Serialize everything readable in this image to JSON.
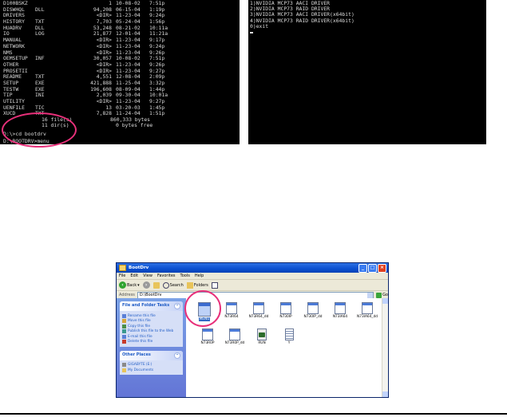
{
  "dos1": {
    "files": [
      {
        "name": "D100BSKZ",
        "ext": "",
        "size": "1",
        "date": "10-08-02",
        "time": "7:51p"
      },
      {
        "name": "DISWHQL",
        "ext": "DLL",
        "size": "94,208",
        "date": "06-15-04",
        "time": "1:19p"
      },
      {
        "name": "DRIVERS",
        "ext": "",
        "size": "<DIR>",
        "date": "11-23-04",
        "time": "9:24p"
      },
      {
        "name": "HISTORY",
        "ext": "TXT",
        "size": "7,703",
        "date": "05-24-04",
        "time": "1:56p"
      },
      {
        "name": "HUADRV",
        "ext": "DLL",
        "size": "53,248",
        "date": "08-21-02",
        "time": "10:11a"
      },
      {
        "name": "IO",
        "ext": "LOG",
        "size": "21,877",
        "date": "12-01-04",
        "time": "11:21a"
      },
      {
        "name": "MANUAL",
        "ext": "",
        "size": "<DIR>",
        "date": "11-23-04",
        "time": "9:17p"
      },
      {
        "name": "NETWORK",
        "ext": "",
        "size": "<DIR>",
        "date": "11-23-04",
        "time": "9:24p"
      },
      {
        "name": "NMS",
        "ext": "",
        "size": "<DIR>",
        "date": "11-23-04",
        "time": "9:26p"
      },
      {
        "name": "OEMSETUP",
        "ext": "INF",
        "size": "30,057",
        "date": "10-08-02",
        "time": "7:51p"
      },
      {
        "name": "OTHER",
        "ext": "",
        "size": "<DIR>",
        "date": "11-23-04",
        "time": "9:26p"
      },
      {
        "name": "PROSETII",
        "ext": "",
        "size": "<DIR>",
        "date": "11-23-04",
        "time": "9:27p"
      },
      {
        "name": "README",
        "ext": "TXT",
        "size": "4,551",
        "date": "12-08-04",
        "time": "2:09p"
      },
      {
        "name": "SETUP",
        "ext": "EXE",
        "size": "421,888",
        "date": "11-25-04",
        "time": "3:32p"
      },
      {
        "name": "TESTW",
        "ext": "EXE",
        "size": "196,608",
        "date": "08-09-04",
        "time": "1:44p"
      },
      {
        "name": "TIP",
        "ext": "INI",
        "size": "2,039",
        "date": "09-30-04",
        "time": "10:01a"
      },
      {
        "name": "UTILITY",
        "ext": "",
        "size": "<DIR>",
        "date": "11-23-04",
        "time": "9:27p"
      },
      {
        "name": "UENFILE",
        "ext": "TIC",
        "size": "13",
        "date": "03-20-03",
        "time": "1:45p"
      },
      {
        "name": "XUCD",
        "ext": "TXT",
        "size": "7,828",
        "date": "11-24-04",
        "time": "1:51p"
      }
    ],
    "summary_files": "16 file(s)",
    "summary_bytes": "860,333 bytes",
    "summary_dirs": "11 dir(s)",
    "summary_free": "0 bytes free",
    "prompt1": "D:\\>cd bootdrv",
    "prompt2": "D:\\BOOTDRV>menu"
  },
  "dos2": {
    "menu": [
      "1)NVIDIA MCP73 AACI DRIVER",
      "2)NVIDIA MCP73 RAID DRIVER",
      "3)NVIDIA MCP73 AACI DRIVER(x64bit)",
      "4)NVIDIA MCP73 RAID DRIVER(x64bit)",
      "0)exit"
    ]
  },
  "explorer": {
    "title": "BootDrv",
    "menu": [
      "File",
      "Edit",
      "View",
      "Favorites",
      "Tools",
      "Help"
    ],
    "toolbar": {
      "back": "Back",
      "search": "Search",
      "folders": "Folders"
    },
    "address_label": "Address",
    "address_value": "D:\\BootDrv",
    "go_label": "Go",
    "task_title": "File and Folder Tasks",
    "tasks": [
      "Rename this file",
      "Move this file",
      "Copy this file",
      "Publish this file to the Web",
      "E-mail this file",
      "Delete this file"
    ],
    "other_title": "Other Places",
    "other_places": [
      "GIGABYTE (E:)",
      "My Documents"
    ],
    "files_row1": [
      "MENU",
      "N73R64",
      "N73R64_dd",
      "N730IP",
      "N730IP_dd",
      "N73IA64",
      "N73IA64_dd"
    ],
    "files_row2": [
      "N73R0P",
      "N73R0P_dd",
      "RUN",
      "Y"
    ]
  },
  "colors": {
    "highlight": "#e8307a",
    "xp_blue": "#0a4fd0",
    "task_link": "#215dc6"
  }
}
